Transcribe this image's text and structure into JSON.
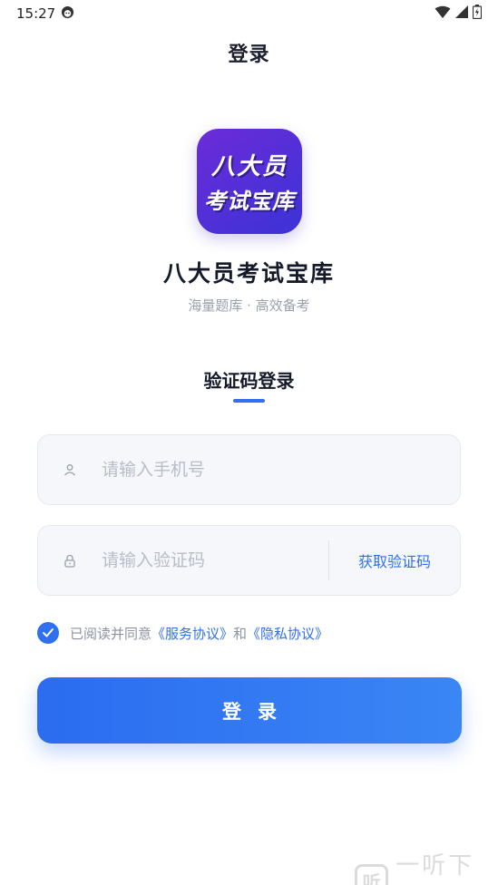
{
  "status_bar": {
    "time": "15:27",
    "icons": [
      "face-icon",
      "wifi-icon",
      "signal-icon",
      "battery-icon"
    ]
  },
  "header": {
    "title": "登录"
  },
  "app": {
    "icon_line1": "八大员",
    "icon_line2": "考试宝库",
    "name": "八大员考试宝库",
    "slogan": "海量题库 · 高效备考"
  },
  "tab": {
    "label": "验证码登录"
  },
  "phone_field": {
    "placeholder": "请输入手机号",
    "value": "",
    "icon": "user-icon"
  },
  "code_field": {
    "placeholder": "请输入验证码",
    "value": "",
    "icon": "lock-icon",
    "get_code_label": "获取验证码"
  },
  "agreement": {
    "checked": true,
    "prefix": "已阅读并同意",
    "service_link": "《服务协议》",
    "conjunction": "和",
    "privacy_link": "《隐私协议》"
  },
  "login_button": {
    "label": "登录"
  },
  "watermark": {
    "logo": "听",
    "text": "一听下载"
  },
  "colors": {
    "accent": "#2f6ff0",
    "icon_gradient_start": "#6c2bd9",
    "icon_gradient_end": "#3b33d6"
  }
}
